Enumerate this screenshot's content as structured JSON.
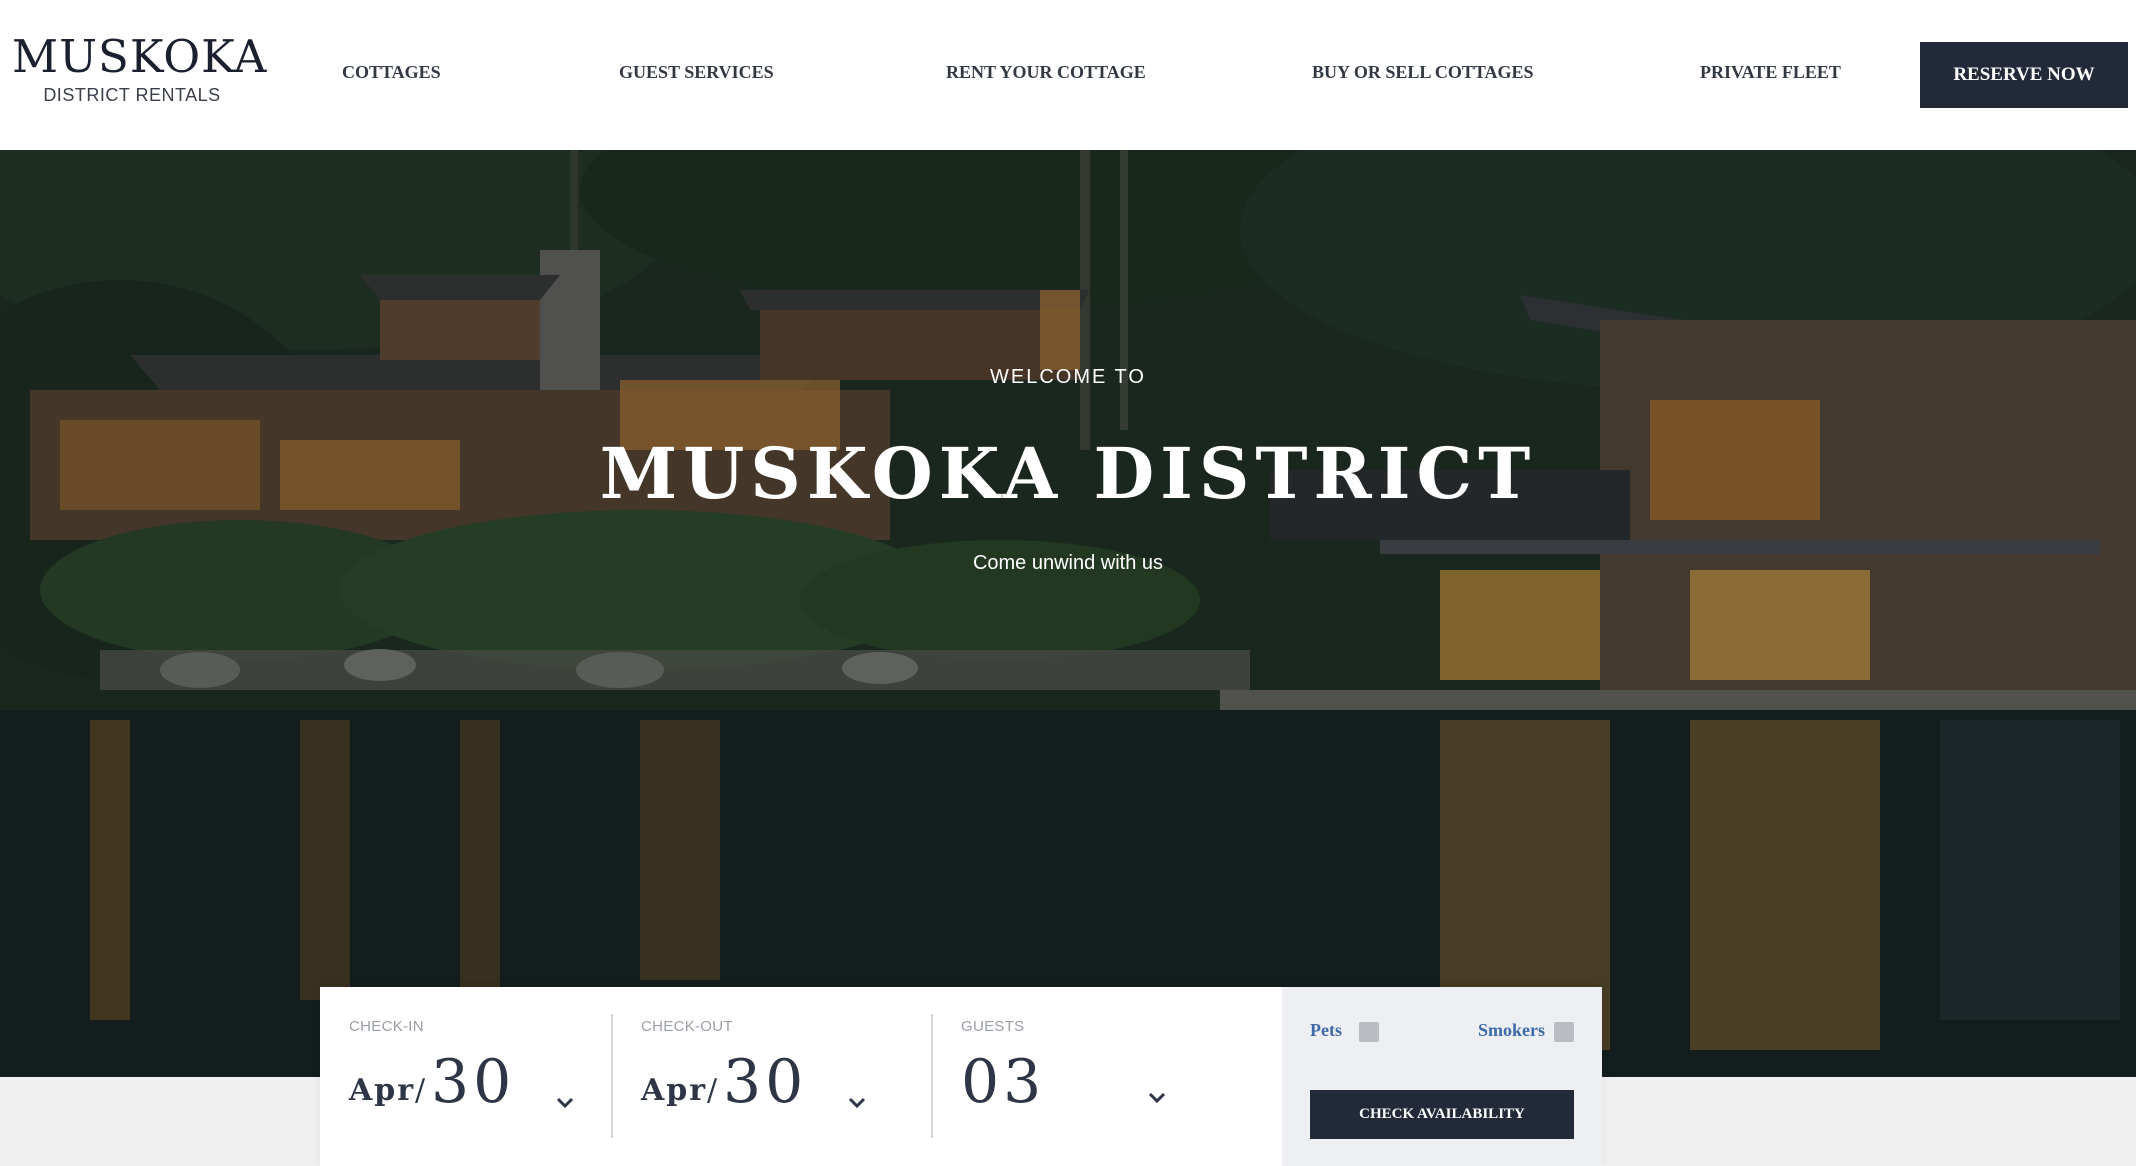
{
  "brand": {
    "name": "MUSKOKA",
    "tagline": "DISTRICT RENTALS"
  },
  "nav": {
    "items": [
      {
        "label": "COTTAGES"
      },
      {
        "label": "GUEST SERVICES"
      },
      {
        "label": "RENT YOUR COTTAGE"
      },
      {
        "label": "BUY OR SELL COTTAGES"
      },
      {
        "label": "PRIVATE FLEET"
      }
    ],
    "cta_label": "RESERVE NOW"
  },
  "hero": {
    "eyebrow": "WELCOME TO",
    "title": "MUSKOKA DISTRICT",
    "subtitle": "Come unwind with us"
  },
  "booking": {
    "checkin": {
      "label": "CHECK-IN",
      "month": "Apr",
      "separator": "/",
      "day": "30"
    },
    "checkout": {
      "label": "CHECK-OUT",
      "month": "Apr",
      "separator": "/",
      "day": "30"
    },
    "guests": {
      "label": "GUESTS",
      "count": "03"
    },
    "options": {
      "pets_label": "Pets",
      "smokers_label": "Smokers"
    },
    "submit_label": "CHECK AVAILABILITY"
  },
  "colors": {
    "navy": "#222a3a",
    "option_blue": "#3d6aa8",
    "panel_gray": "#edeff2",
    "page_gray": "#f0f0f0"
  }
}
